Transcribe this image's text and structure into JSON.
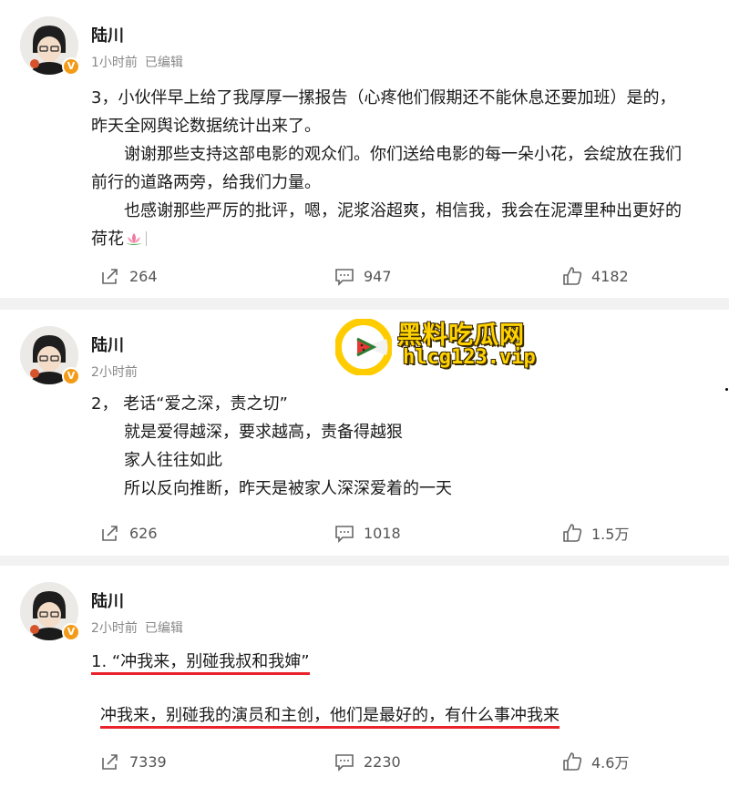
{
  "posts": [
    {
      "username": "陆川",
      "time": "1小时前",
      "edited": "已编辑",
      "lines": [
        "3，小伙伴早上给了我厚厚一摞报告（心疼他们假期还不能休息还要加班）是的，",
        "昨天全网舆论数据统计出来了。",
        "谢谢那些支持这部电影的观众们。你们送给电影的每一朵小花，会绽放在我们",
        "前行的道路两旁，给我们力量。",
        "也感谢那些严厉的批评，嗯，泥浆浴超爽，相信我，我会在泥潭里种出更好的",
        "荷花"
      ],
      "shares": "264",
      "comments": "947",
      "likes": "4182"
    },
    {
      "username": "陆川",
      "time": "2小时前",
      "lines": [
        "2，  老话“爱之深，责之切”",
        "就是爱得越深，要求越高，责备得越狠",
        "家人往往如此",
        "所以反向推断，昨天是被家人深深爱着的一天"
      ],
      "shares": "626",
      "comments": "1018",
      "likes": "1.5万"
    },
    {
      "username": "陆川",
      "time": "2小时前",
      "edited": "已编辑",
      "lines": [
        "1. “冲我来，别碰我叔和我婶”",
        "冲我来，别碰我的演员和主创，他们是最好的，有什么事冲我来"
      ],
      "shares": "7339",
      "comments": "2230",
      "likes": "4.6万"
    }
  ],
  "watermark": {
    "title": "黑料吃瓜网",
    "url": "hlcg123.vip"
  },
  "icons": {
    "share": "share-icon",
    "comment": "comment-icon",
    "like": "thumbs-up-icon",
    "verified": "verified-badge-icon",
    "lotus": "lotus-emoji-icon"
  },
  "colors": {
    "accent_underline": "#e8232b",
    "verified_badge": "#f39a16",
    "watermark": "#ffd200"
  }
}
